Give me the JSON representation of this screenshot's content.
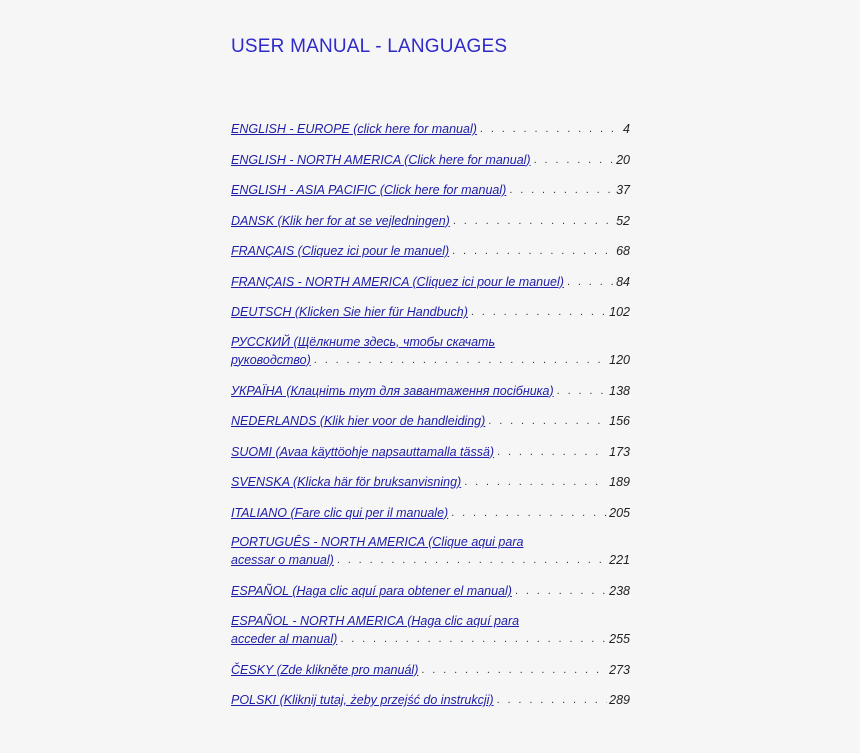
{
  "title": "USER MANUAL - LANGUAGES",
  "entries": [
    {
      "label": "ENGLISH - EUROPE (click here for manual)",
      "page": "4"
    },
    {
      "label": "ENGLISH - NORTH AMERICA (Click here for manual)",
      "page": "20"
    },
    {
      "label": "ENGLISH - ASIA PACIFIC (Click here for manual)",
      "page": "37"
    },
    {
      "label": "DANSK (Klik her for at se vejledningen)",
      "page": "52"
    },
    {
      "label": "FRANÇAIS (Cliquez ici pour le manuel)",
      "page": "68"
    },
    {
      "label": "FRANÇAIS - NORTH AMERICA (Cliquez ici pour le manuel)",
      "page": "84"
    },
    {
      "label": "DEUTSCH (Klicken Sie hier für Handbuch)",
      "page": "102"
    },
    {
      "label_line1": "РУССКИЙ (Щёлкните здесь, чтобы скачать",
      "label_line2": "руководство)",
      "page": "120"
    },
    {
      "label": "УКРАЇНА (Клацніть тут для завантаження посібника)",
      "page": "138"
    },
    {
      "label": "NEDERLANDS (Klik hier voor de handleiding)",
      "page": "156"
    },
    {
      "label": "SUOMI (Avaa käyttöohje napsauttamalla tässä)",
      "page": "173"
    },
    {
      "label": "SVENSKA (Klicka här för bruksanvisning)",
      "page": "189"
    },
    {
      "label": "ITALIANO (Fare clic qui per il manuale)",
      "page": "205"
    },
    {
      "label_line1": "PORTUGUÊS - NORTH AMERICA (Clique aqui para",
      "label_line2": "acessar o manual)",
      "page": "221"
    },
    {
      "label": "ESPAÑOL (Haga clic aquí para obtener el manual)",
      "page": "238"
    },
    {
      "label_line1": "ESPAÑOL - NORTH AMERICA (Haga clic aquí para",
      "label_line2": "acceder al manual)",
      "page": "255"
    },
    {
      "label": "ČESKY (Zde klikněte pro manuál)",
      "page": "273"
    },
    {
      "label": "POLSKI (Kliknij tutaj, żeby przejść do instrukcji)",
      "page": "289"
    }
  ]
}
